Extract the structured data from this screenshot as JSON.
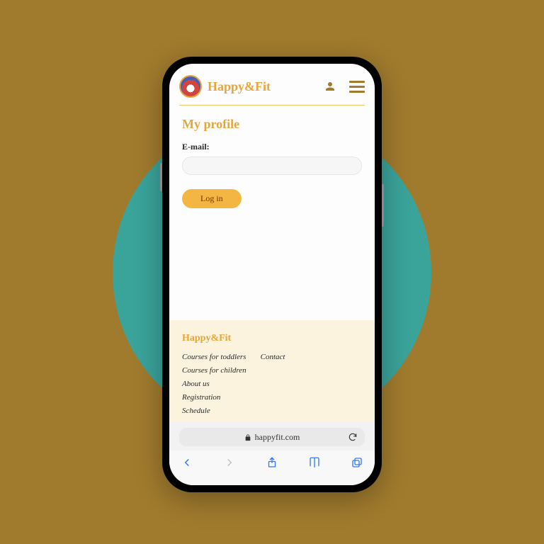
{
  "header": {
    "brand": "Happy&Fit"
  },
  "profile": {
    "title": "My profile",
    "email_label": "E-mail:",
    "login_label": "Log in"
  },
  "footer": {
    "brand": "Happy&Fit",
    "col1": {
      "link0": "Courses for toddlers",
      "link1": "Courses for children",
      "link2": "About us",
      "link3": "Registration",
      "link4": "Schedule"
    },
    "col2": {
      "link0": "Contact"
    }
  },
  "browser": {
    "url": "happyfit.com"
  }
}
